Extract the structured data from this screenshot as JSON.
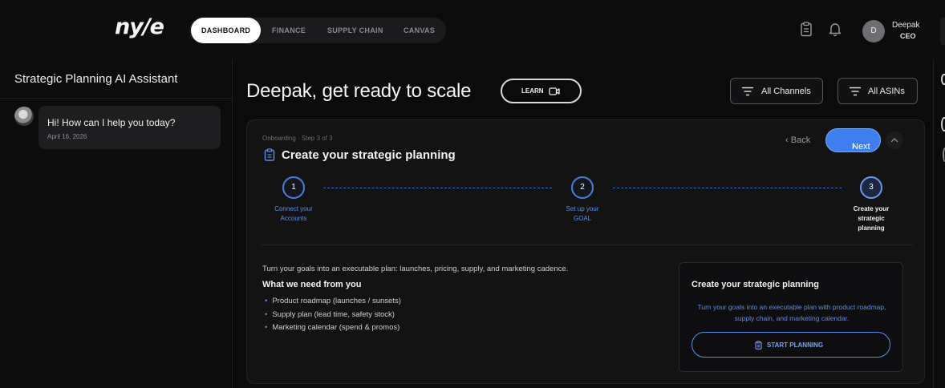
{
  "brand": {
    "logo_text": "ny/e"
  },
  "nav": {
    "tabs": [
      {
        "label": "DASHBOARD",
        "active": true
      },
      {
        "label": "FINANCE",
        "active": false
      },
      {
        "label": "SUPPLY CHAIN",
        "active": false
      },
      {
        "label": "CANVAS",
        "active": false
      }
    ]
  },
  "user": {
    "initial": "D",
    "name": "Deepak",
    "role": "CEO"
  },
  "chat": {
    "title": "Strategic Planning AI Assistant",
    "messages": [
      {
        "text": "Hi! How can I help you today?",
        "date": "April 16, 2026"
      }
    ]
  },
  "main": {
    "headline": "Deepak, get ready to scale",
    "learn_label": "LEARN",
    "filters": {
      "channels": "All Channels",
      "asins": "All ASINs"
    }
  },
  "onboarding": {
    "step_tag": "Onboarding · Step 3 of 3",
    "title": "Create your strategic planning",
    "back_label": "Back",
    "next_label": "Next",
    "steps": [
      {
        "number": "1",
        "label_line1": "Connect your",
        "label_line2": "Accounts",
        "label_line3": ""
      },
      {
        "number": "2",
        "label_line1": "Set up your",
        "label_line2": "GOAL",
        "label_line3": ""
      },
      {
        "number": "3",
        "label_line1": "Create your",
        "label_line2": "strategic",
        "label_line3": "planning"
      }
    ],
    "current_step": 3,
    "intro": "Turn your goals into an executable plan: launches, pricing, supply, and marketing cadence.",
    "needs_title": "What we need from you",
    "needs": [
      "Product roadmap (launches / sunsets)",
      "Supply plan (lead time, safety stock)",
      "Marketing calendar (spend & promos)"
    ],
    "cta": {
      "title": "Create your strategic planning",
      "description": "Turn your goals into an executable plan with product roadmap, supply chain, and marketing calendar.",
      "button_label": "START PLANNING"
    }
  },
  "colors": {
    "accent": "#3d7ef0",
    "accent_text": "#5b8fe8",
    "background": "#0b0b0c",
    "card": "#131314"
  },
  "icons": [
    "clipboard-icon",
    "bell-icon",
    "video-icon",
    "filter-icon",
    "chevron-left-icon",
    "chevron-right-icon",
    "chevron-up-icon"
  ]
}
